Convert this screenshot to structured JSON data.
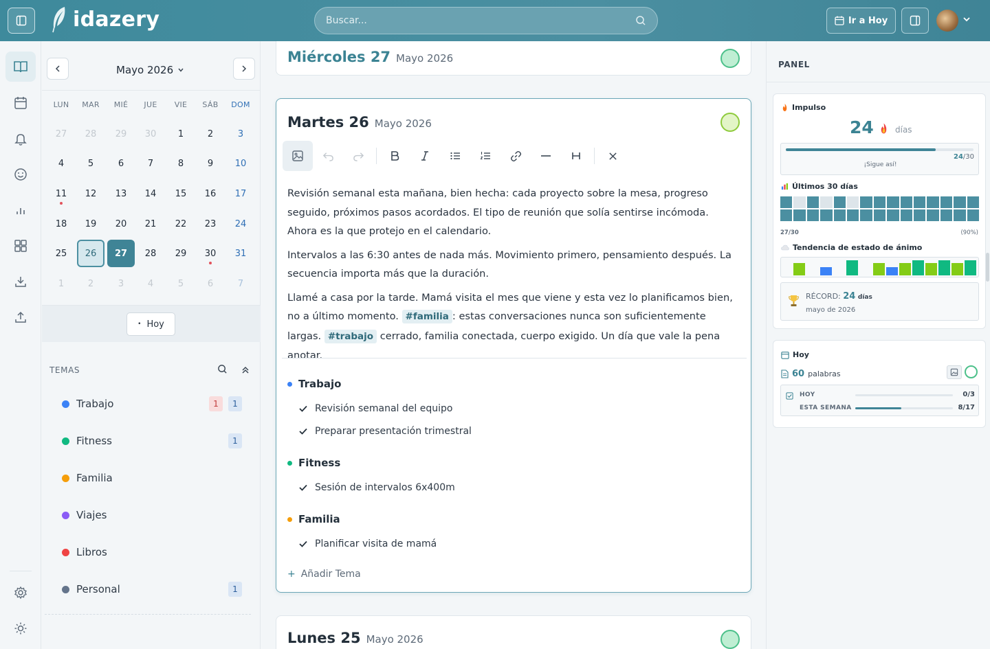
{
  "app": {
    "name": "idazery"
  },
  "search": {
    "placeholder": "Buscar..."
  },
  "header": {
    "goto_today": "Ir a Hoy"
  },
  "calendar": {
    "month_label": "Mayo 2026",
    "weekdays": [
      "LUN",
      "MAR",
      "MIÉ",
      "JUE",
      "VIE",
      "SÁB",
      "DOM"
    ],
    "weeks": [
      [
        "27",
        "28",
        "29",
        "30",
        "1",
        "2",
        "3"
      ],
      [
        "4",
        "5",
        "6",
        "7",
        "8",
        "9",
        "10"
      ],
      [
        "11",
        "12",
        "13",
        "14",
        "15",
        "16",
        "17"
      ],
      [
        "18",
        "19",
        "20",
        "21",
        "22",
        "23",
        "24"
      ],
      [
        "25",
        "26",
        "27",
        "28",
        "29",
        "30",
        "31"
      ],
      [
        "1",
        "2",
        "3",
        "4",
        "5",
        "6",
        "7"
      ]
    ],
    "today_button": "Hoy"
  },
  "topics": {
    "title": "TEMAS",
    "items": [
      {
        "label": "Trabajo",
        "color": "#3b82f6",
        "badge_red": "1",
        "badge_blue": "1"
      },
      {
        "label": "Fitness",
        "color": "#10b981",
        "badge_blue": "1"
      },
      {
        "label": "Familia",
        "color": "#f59e0b"
      },
      {
        "label": "Viajes",
        "color": "#8b5cf6"
      },
      {
        "label": "Libros",
        "color": "#ef4444"
      },
      {
        "label": "Personal",
        "color": "#64748b",
        "badge_blue": "1"
      }
    ]
  },
  "entries": [
    {
      "day": "Miércoles 27",
      "date": "Mayo 2026"
    },
    {
      "day": "Martes 26",
      "date": "Mayo 2026",
      "para1": "Revisión semanal esta mañana, bien hecha: cada proyecto sobre la mesa, progreso seguido, próximos pasos acordados. El tipo de reunión que solía sentirse incómoda. Ahora es la que protejo en el calendario.",
      "para2": "Intervalos a las 6:30 antes de nada más. Movimiento primero, pensamiento después. La secuencia importa más que la duración.",
      "para3_a": "Llamé a casa por la tarde. Mamá visita el mes que viene y esta vez lo planificamos bien, no a último momento.",
      "tag1": "#familia",
      "para3_b": ": estas conversaciones nunca son suficientemente largas.",
      "tag2": "#trabajo",
      "para3_c": "cerrado, familia conectada, cuerpo exigido. Un día que vale la pena anotar.",
      "groups": [
        {
          "name": "Trabajo",
          "color": "#3b82f6",
          "tasks": [
            "Revisión semanal del equipo",
            "Preparar presentación trimestral"
          ]
        },
        {
          "name": "Fitness",
          "color": "#10b981",
          "tasks": [
            "Sesión de intervalos 6x400m"
          ]
        },
        {
          "name": "Familia",
          "color": "#f59e0b",
          "tasks": [
            "Planificar visita de mamá"
          ]
        }
      ],
      "add_topic": "Añadir Tema"
    },
    {
      "day": "Lunes 25",
      "date": "Mayo 2026"
    }
  ],
  "panel": {
    "title": "PANEL",
    "streak": {
      "title": "Impulso",
      "value": "24",
      "unit": "días",
      "progress_current": "24",
      "progress_total": "/30",
      "progress_fraction": 0.8,
      "message": "¡Sigue así!"
    },
    "last30": {
      "title": "Últimos 30 días",
      "days_on": [
        1,
        0,
        1,
        0,
        1,
        0,
        1,
        1,
        1,
        1,
        1,
        1,
        1,
        1,
        1,
        1,
        1,
        1,
        1,
        1,
        1,
        1,
        1,
        1,
        1,
        1,
        1,
        1,
        1,
        1
      ],
      "count": "27/30",
      "percent": "(90%)"
    },
    "mood_trend": {
      "title": "Tendencia de estado de ánimo",
      "bars": [
        {
          "color": "#84cc16",
          "level": 0.75
        },
        {
          "color": "#3b82f6",
          "level": 0.5
        },
        {
          "color": "#10b981",
          "level": 0.9
        },
        {
          "color": "#84cc16",
          "level": 0.75
        },
        {
          "color": "#3b82f6",
          "level": 0.5
        },
        {
          "color": "#84cc16",
          "level": 0.75
        },
        {
          "color": "#10b981",
          "level": 0.9
        },
        {
          "color": "#84cc16",
          "level": 0.75
        },
        {
          "color": "#10b981",
          "level": 0.9
        },
        {
          "color": "#84cc16",
          "level": 0.75
        },
        {
          "color": "#10b981",
          "level": 0.9
        }
      ]
    },
    "record": {
      "label": "RÉCORD:",
      "value": "24",
      "unit": "días",
      "when": "mayo de 2026"
    },
    "today": {
      "title": "Hoy",
      "words": "60",
      "words_label": "palabras",
      "today_label": "HOY",
      "today_val": "0/3",
      "today_fraction": 0,
      "week_label": "ESTA SEMANA",
      "week_val": "8/17",
      "week_fraction": 0.47
    }
  }
}
